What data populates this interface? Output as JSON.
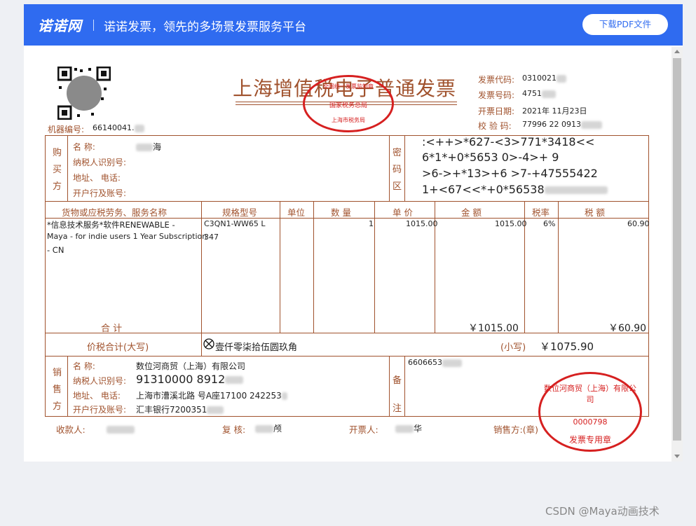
{
  "header": {
    "logo": "诺诺网",
    "slogan": "诺诺发票，领先的多场景发票服务平台",
    "download_label": "下载PDF文件"
  },
  "invoice": {
    "title": "上海增值税电子普通发票",
    "machine_no_label": "机器编号:",
    "machine_no": "66140041.",
    "meta": {
      "code_label": "发票代码:",
      "code": "0310021",
      "number_label": "发票号码:",
      "number": "4751",
      "date_label": "开票日期:",
      "date": "2021年 11月23日",
      "check_label": "校 验 码:",
      "check": "77996   22 0913"
    },
    "buyer": {
      "side_label": "购买方",
      "name_label": "名          称:",
      "name": "海",
      "taxid_label": "纳税人识别号:",
      "addr_label": "地址、 电话:",
      "bank_label": "开户行及账号:"
    },
    "cipher": {
      "side_label": "密码区",
      "lines": [
        ":<++>*627-<3>771*3418<<",
        "6*1*+0*5653   0>-4>+    9",
        ">6->+*13>+6    >7-+47555422",
        "1+<67<<*+0*56538"
      ]
    },
    "items_header": {
      "name": "货物或应税劳务、服务名称",
      "model": "规格型号",
      "unit": "单位",
      "qty": "数 量",
      "price": "单 价",
      "amount": "金 额",
      "rate": "税率",
      "tax": "税 额"
    },
    "item": {
      "name_line1": "*信息技术服务*软件RENEWABLE -",
      "name_line2": "Maya - for indie users 1 Year Subscription",
      "name_line3": "- CN",
      "model_line1": "C3QN1-WW65   L",
      "model_line2": "347",
      "qty": "1",
      "price": "1015.00",
      "amount": "1015.00",
      "rate": "6%",
      "tax": "60.90"
    },
    "subtotal": {
      "label": "合          计",
      "amount": "￥1015.00",
      "tax": "￥60.90"
    },
    "total": {
      "label": "价税合计(大写)",
      "upper": "壹仟零柒拾伍圆玖角",
      "small_label": "(小写)",
      "small": "￥1075.90"
    },
    "seller": {
      "side_label": "销售方",
      "name_label": "名          称:",
      "name": "数位河商贸（上海）有限公司",
      "taxid_label": "纳税人识别号:",
      "taxid": "91310000   8912",
      "addr_label": "地址、 电话:",
      "addr": "上海市漕溪北路  号A座17100   242253",
      "bank_label": "开户行及账号:",
      "bank": "汇丰银行7200351"
    },
    "remark": {
      "side_label": "备注",
      "text": "6606653"
    },
    "footer": {
      "payee_label": "收款人:",
      "reviewer_label": "复 核:",
      "reviewer": "颅",
      "issuer_label": "开票人:",
      "issuer": "华",
      "seller_label": "销售方:(章)"
    },
    "stamp_tax": {
      "top": "全国统一发票监制章",
      "mid": "国家税务总局",
      "bottom": "上海市税务局"
    },
    "stamp_seller": {
      "top": "数位河商贸（上海）有限公司",
      "num": "0000798",
      "bottom": "发票专用章"
    }
  },
  "watermark": "CSDN @Maya动画技术"
}
